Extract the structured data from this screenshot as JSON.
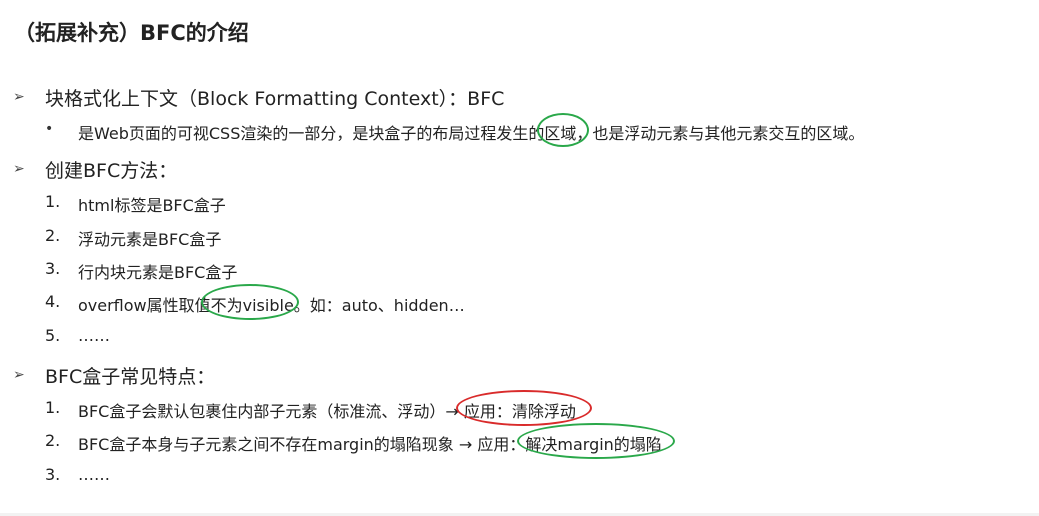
{
  "title": "（拓展补充）BFC的介绍",
  "section1": {
    "heading": "块格式化上下文（Block Formatting Context）：BFC",
    "bullet": {
      "before": "是Web页面的可视CSS渲染的一部分，是块盒子的布局过程发生的",
      "highlight": "区域",
      "after": "，也是浮动元素与其他元素交互的区域。"
    }
  },
  "section2": {
    "heading": "创建BFC方法：",
    "items": [
      {
        "num": "1.",
        "text": "html标签是BFC盒子"
      },
      {
        "num": "2.",
        "text": "浮动元素是BFC盒子"
      },
      {
        "num": "3.",
        "text": "行内块元素是BFC盒子"
      },
      {
        "num": "4.",
        "before": "overflow属性取值",
        "highlight": "不为visible",
        "after": "。如：auto、hidden…"
      },
      {
        "num": "5.",
        "text": "……"
      }
    ]
  },
  "section3": {
    "heading": "BFC盒子常见特点：",
    "items": [
      {
        "num": "1.",
        "before": "BFC盒子会默认包裹住内部子元素（标准流、浮动）→ ",
        "highlight": "应用：清除浮动"
      },
      {
        "num": "2.",
        "before": "BFC盒子本身与子元素之间不存在margin的塌陷现象 → 应用：",
        "highlight": "解决margin的塌陷"
      },
      {
        "num": "3.",
        "text": "……"
      }
    ]
  },
  "colors": {
    "ring_green": "#2aa84a",
    "ring_red": "#d92b2b",
    "text": "#222222"
  },
  "icons": {
    "section_bullet": "arrowhead-bullet",
    "sub_bullet": "dot-bullet"
  }
}
